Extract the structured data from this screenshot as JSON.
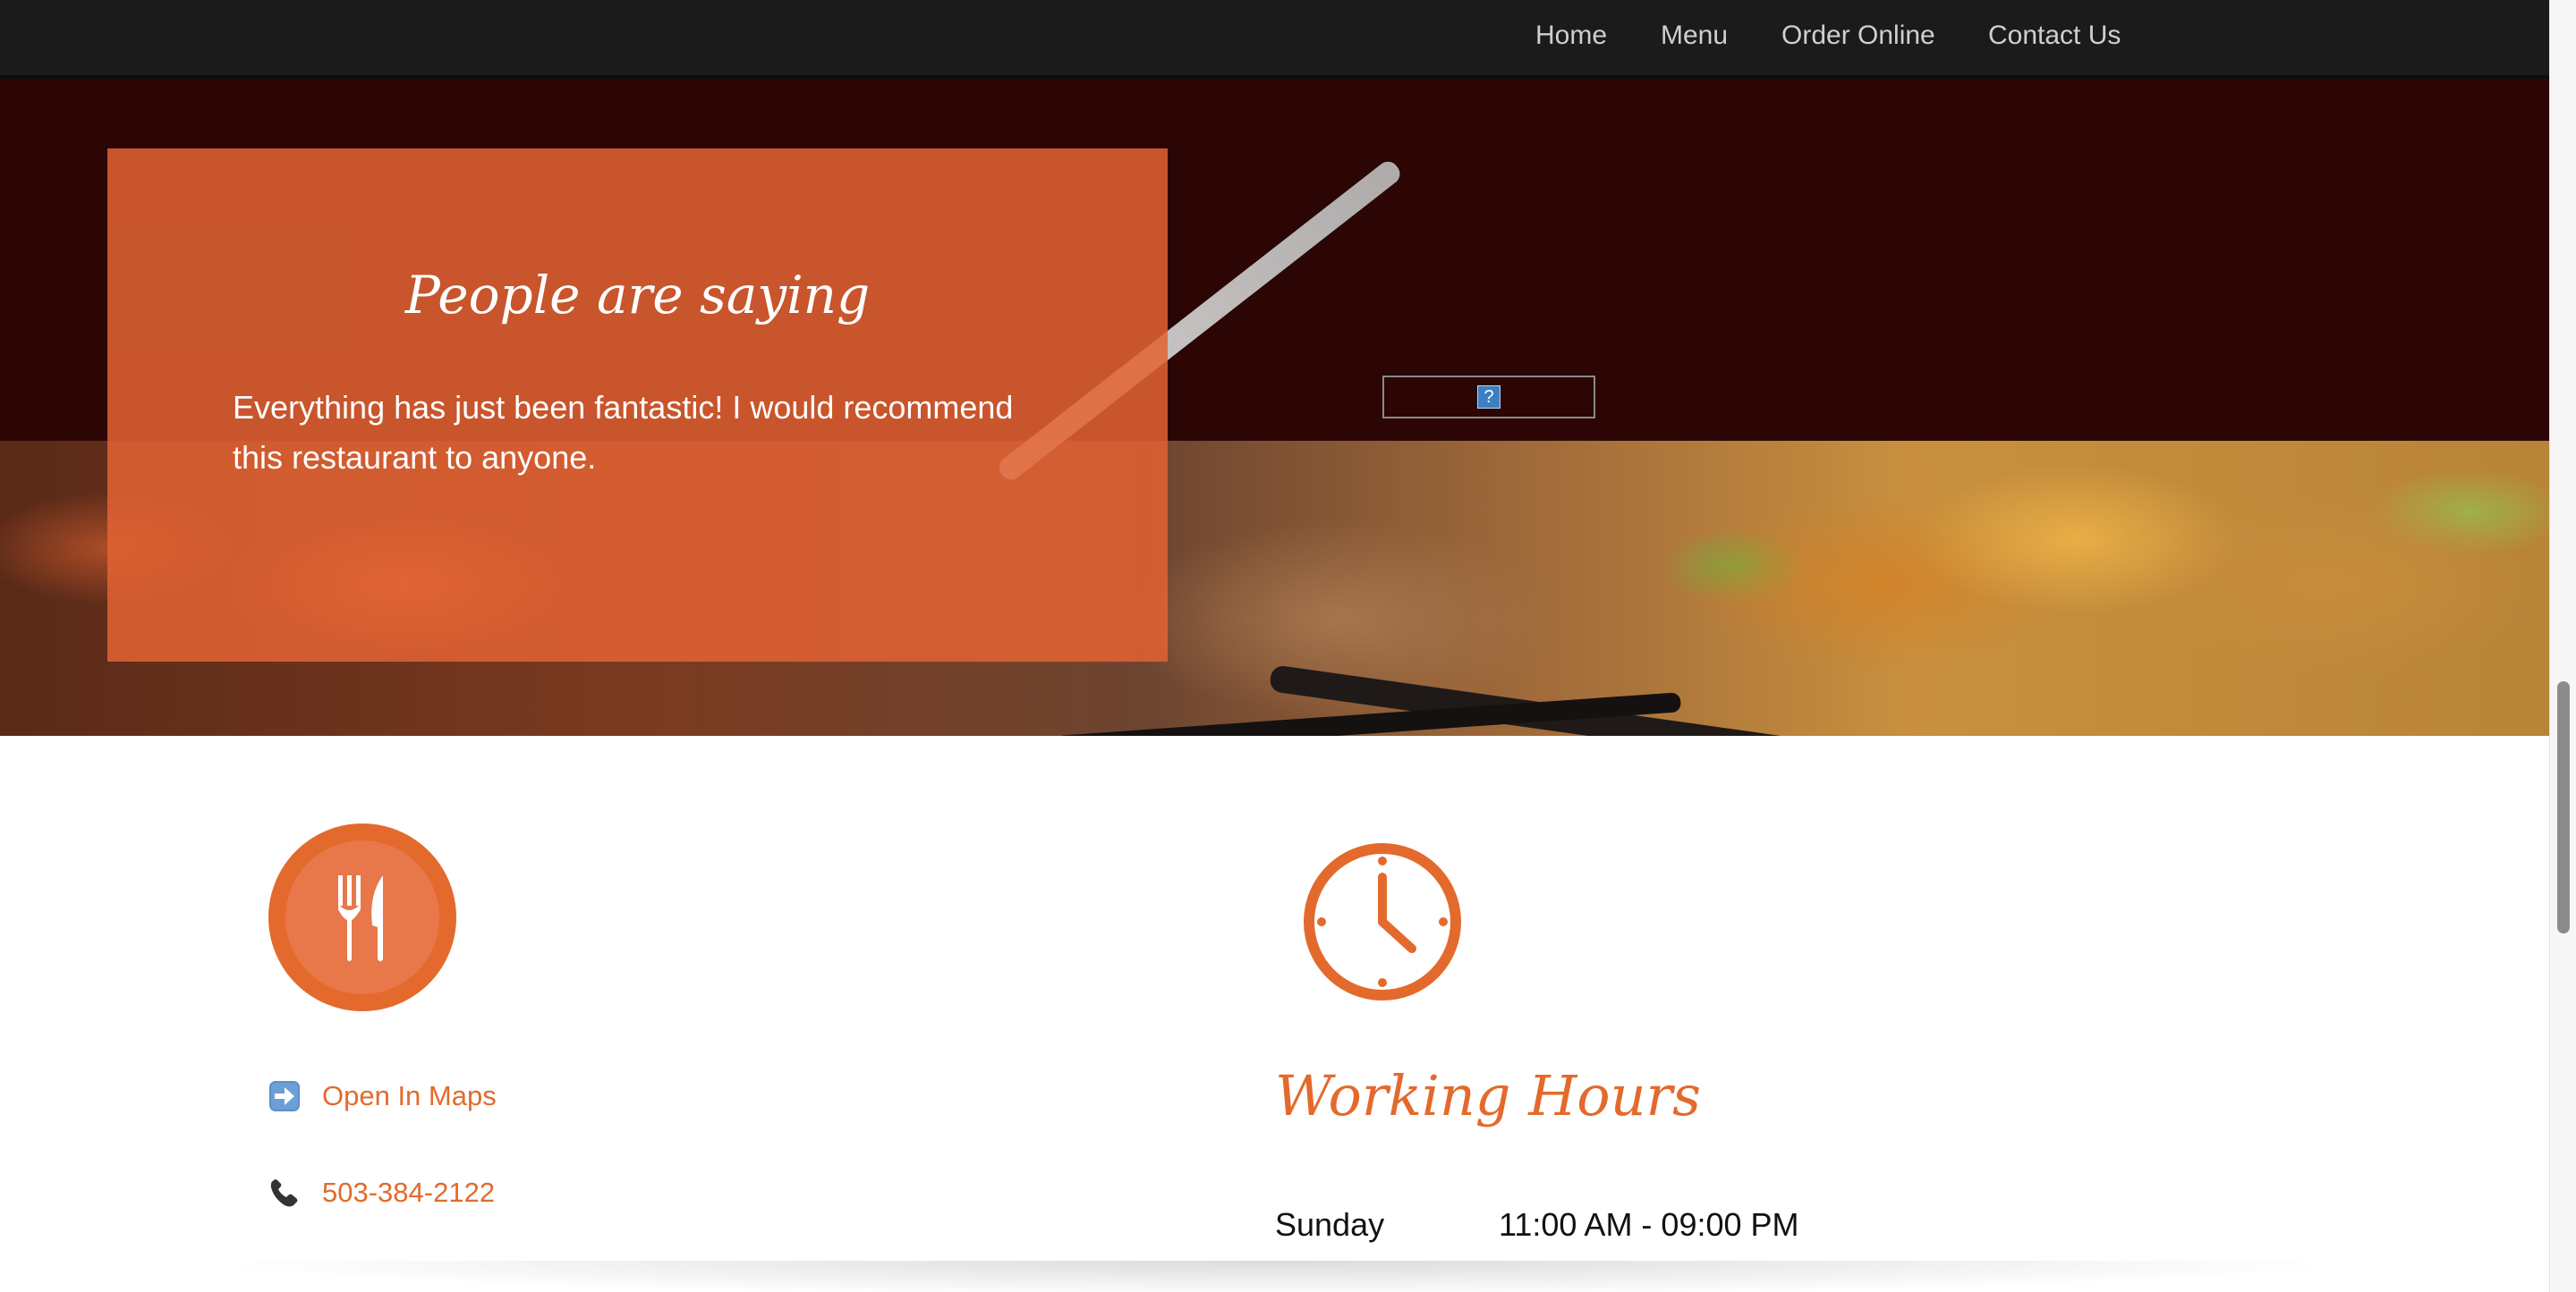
{
  "nav": {
    "items": [
      {
        "label": "Home"
      },
      {
        "label": "Menu"
      },
      {
        "label": "Order Online"
      },
      {
        "label": "Contact Us"
      }
    ]
  },
  "testimonial": {
    "title": "People are saying",
    "text": "Everything has just been fantastic! I would recommend this restaurant to anyone."
  },
  "broken_embed": {
    "glyph": "?"
  },
  "location": {
    "icon": "fork-knife-icon",
    "maps_link": {
      "icon": "right-arrow-icon",
      "label": "Open In Maps"
    },
    "phone": {
      "icon": "phone-icon",
      "label": "503-384-2122"
    }
  },
  "hours": {
    "icon": "clock-icon",
    "title": "Working Hours",
    "rows": [
      {
        "day": "Sunday",
        "time": "11:00 AM - 09:00 PM"
      }
    ]
  },
  "colors": {
    "accent": "#e36a2c",
    "nav_bg": "#1b1b1b",
    "hero_bg": "#2b0605"
  }
}
